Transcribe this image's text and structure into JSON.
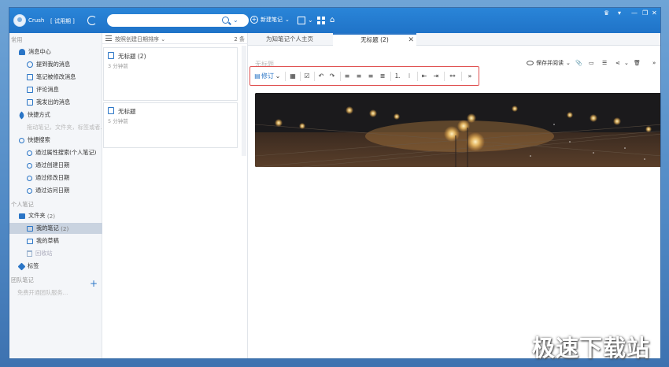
{
  "titlebar": {
    "user_name": "Crush",
    "account_type": "[ 试用期 ]",
    "search_placeholder": "",
    "search_dropdown": "⌄",
    "new_note_label": "新建笔记",
    "new_note_caret": "⌄",
    "sq_caret": "⌄",
    "window_controls": [
      "♛",
      "▾",
      "—",
      "❐",
      "✕"
    ]
  },
  "sidebar": {
    "section_common": "常用",
    "messages": "消息中心",
    "msg_mention": "提到我的消息",
    "msg_modified": "笔记被修改消息",
    "msg_comment": "评论消息",
    "msg_sent": "我发出的消息",
    "shortcuts": "快捷方式",
    "shortcuts_hint": "拖动笔记，文件夹，标签或者...",
    "quick_search": "快捷搜索",
    "qs_attr": "通过属性搜索(个人笔记)",
    "qs_created": "通过创建日期",
    "qs_modified": "通过修改日期",
    "qs_visited": "通过访问日期",
    "section_personal": "个人笔记",
    "folders": "文件夹",
    "folders_count": "(2)",
    "my_notes": "我的笔记",
    "my_notes_count": "(2)",
    "my_drafts": "我的草稿",
    "recycle": "回收站",
    "tags": "标签",
    "section_team": "团队笔记",
    "team_add": "+",
    "team_hint": "免费开通团队服务..."
  },
  "notelist": {
    "sort_label": "按照创建日期排序 ⌄",
    "count": "2 条",
    "notes": [
      {
        "title": "无标题 (2)",
        "time": "3 分钟前"
      },
      {
        "title": "无标题",
        "time": "5 分钟前"
      }
    ]
  },
  "editor": {
    "tabs": [
      {
        "label": "为知笔记个人主页"
      },
      {
        "label": "无标题 (2)"
      }
    ],
    "tab_close": "✕",
    "title_placeholder": "无标题",
    "save_read_label": "保存并阅读",
    "save_caret": "⌄",
    "more": "»",
    "toolbar": {
      "revise": "修订",
      "revise_caret": "⌄",
      "more": "»"
    }
  },
  "watermark": "极速下载站",
  "colors": {
    "accent": "#2a75c6",
    "titlebar": "#1f73c8",
    "highlight_box": "#e05151",
    "sidebar_bg": "#f4f6f9",
    "selected_row": "#c9d3e0"
  }
}
